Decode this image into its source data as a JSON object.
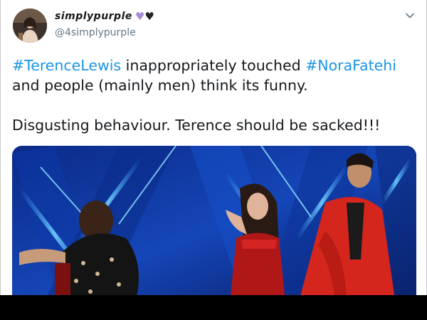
{
  "tweet": {
    "display_name": "simplypurple",
    "hearts": [
      {
        "icon": "purple-heart-icon",
        "glyph": "♥",
        "color": "#a78bd6"
      },
      {
        "icon": "black-heart-icon",
        "glyph": "♥",
        "color": "#222222"
      }
    ],
    "handle": "@4simplypurple",
    "text": {
      "hashtag_1": "#TerenceLewis",
      "part_1": " inappropriately touched ",
      "hashtag_2": "#NoraFatehi",
      "part_2": "and people (mainly men) think its funny.",
      "line_3": "Disgusting behaviour. Terence should be sacked!!!"
    },
    "colors": {
      "hashtag": "#1b95e0",
      "text": "#14171a",
      "secondary": "#657786"
    }
  }
}
